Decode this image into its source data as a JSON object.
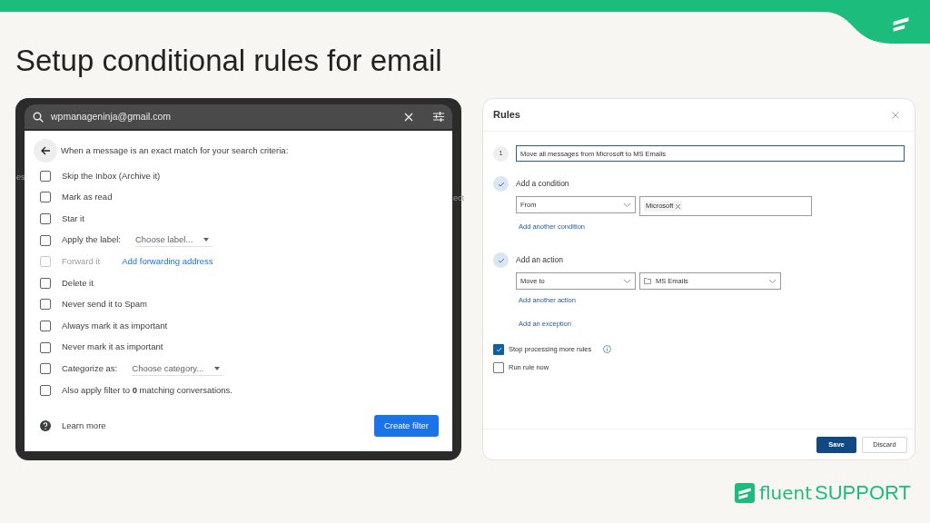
{
  "title": "Setup conditional rules for email",
  "gmail_filter": {
    "search": {
      "value": "wpmanageninja@gmail.com"
    },
    "background_fragments": [
      "es",
      "ect"
    ],
    "heading": "When a message is an exact match for your search criteria:",
    "options": [
      {
        "kind": "plain",
        "label": "Skip the Inbox (Archive it)",
        "checked": false,
        "disabled": false
      },
      {
        "kind": "plain",
        "label": "Mark as read",
        "checked": false,
        "disabled": false
      },
      {
        "kind": "plain",
        "label": "Star it",
        "checked": false,
        "disabled": false
      },
      {
        "kind": "select",
        "label": "Apply the label:",
        "select": "Choose label...",
        "checked": false,
        "disabled": false
      },
      {
        "kind": "link",
        "label": "Forward it",
        "link": "Add forwarding address",
        "checked": false,
        "disabled": true
      },
      {
        "kind": "plain",
        "label": "Delete it",
        "checked": false,
        "disabled": false
      },
      {
        "kind": "plain",
        "label": "Never send it to Spam",
        "checked": false,
        "disabled": false
      },
      {
        "kind": "plain",
        "label": "Always mark it as important",
        "checked": false,
        "disabled": false
      },
      {
        "kind": "plain",
        "label": "Never mark it as important",
        "checked": false,
        "disabled": false
      },
      {
        "kind": "select",
        "label": "Categorize as:",
        "select": "Choose category...",
        "checked": false,
        "disabled": false
      },
      {
        "kind": "rich",
        "label": "Also apply filter to **0** matching conversations.",
        "checked": false,
        "disabled": false
      }
    ],
    "learn_more": "Learn more",
    "create_button": "Create filter"
  },
  "rules_dialog": {
    "title": "Rules",
    "rule_number": "1",
    "rule_name": "Move all messages from Microsoft to MS Emails",
    "condition": {
      "heading": "Add a condition",
      "done": true,
      "field": "From",
      "chips": [
        "Microsoft"
      ],
      "add_link": "Add another condition"
    },
    "action": {
      "heading": "Add an action",
      "done": true,
      "field": "Move to",
      "folder": "MS Emails",
      "add_link": "Add another action"
    },
    "exception_link": "Add an exception",
    "options": [
      {
        "label": "Stop processing more rules",
        "checked": true,
        "info": true
      },
      {
        "label": "Run rule now",
        "checked": false,
        "info": false
      }
    ],
    "save_button": "Save",
    "discard_button": "Discard"
  },
  "brand": {
    "light": "fluent",
    "bold": "SUPPORT"
  }
}
